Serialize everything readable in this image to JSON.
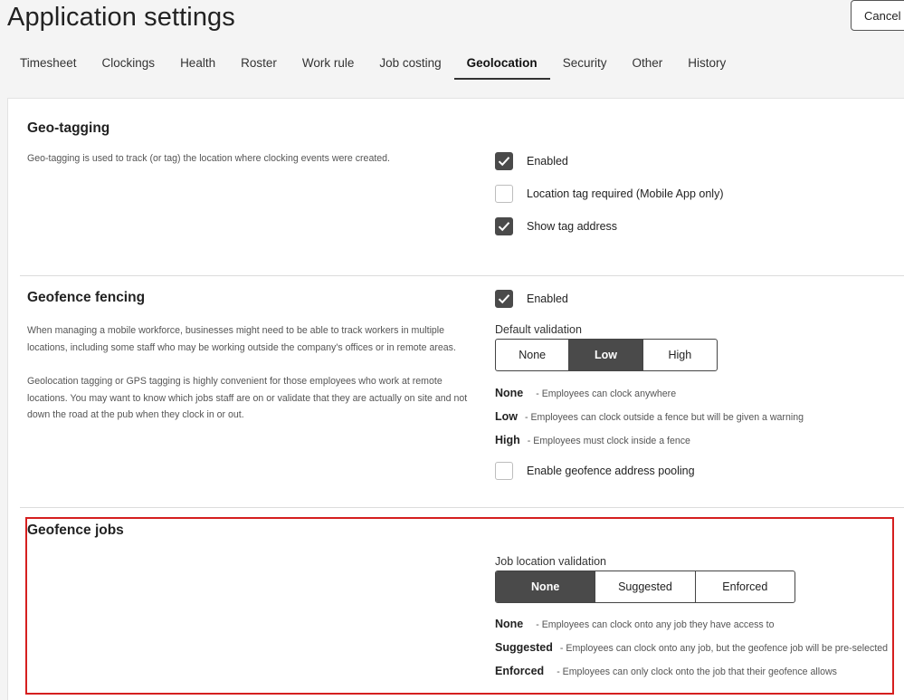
{
  "header": {
    "title": "Application settings",
    "cancel_label": "Cancel"
  },
  "tabs": [
    {
      "label": "Timesheet"
    },
    {
      "label": "Clockings"
    },
    {
      "label": "Health"
    },
    {
      "label": "Roster"
    },
    {
      "label": "Work rule"
    },
    {
      "label": "Job costing"
    },
    {
      "label": "Geolocation",
      "active": true
    },
    {
      "label": "Security"
    },
    {
      "label": "Other"
    },
    {
      "label": "History"
    }
  ],
  "geo_tagging": {
    "title": "Geo-tagging",
    "description": "Geo-tagging is used to track (or tag) the location where clocking events were created.",
    "options": [
      {
        "label": "Enabled",
        "checked": true
      },
      {
        "label": "Location tag required (Mobile App only)",
        "checked": false
      },
      {
        "label": "Show tag address",
        "checked": true
      }
    ]
  },
  "geofence_fencing": {
    "title": "Geofence fencing",
    "description_1": "When managing a mobile workforce, businesses might need to be able to track workers in multiple locations, including some staff who may be working outside the company's offices or in remote areas.",
    "description_2": "Geolocation tagging or GPS tagging is highly convenient for those employees who work at remote locations. You may want to know which jobs staff are on or validate that they are actually on site and not down the road at the pub when they clock in or out.",
    "enabled": {
      "label": "Enabled",
      "checked": true
    },
    "validation_label": "Default validation",
    "validation_options": [
      "None",
      "Low",
      "High"
    ],
    "validation_selected": "Low",
    "legend": [
      {
        "name": "None",
        "desc": "- Employees can clock anywhere"
      },
      {
        "name": "Low",
        "desc": "- Employees can clock outside a fence but will be given a warning"
      },
      {
        "name": "High",
        "desc": "- Employees must clock inside a fence"
      }
    ],
    "pooling": {
      "label": "Enable geofence address pooling",
      "checked": false
    }
  },
  "geofence_jobs": {
    "title": "Geofence jobs",
    "validation_label": "Job location validation",
    "validation_options": [
      "None",
      "Suggested",
      "Enforced"
    ],
    "validation_selected": "None",
    "legend": [
      {
        "name": "None",
        "desc": "- Employees can clock onto any job they have access to"
      },
      {
        "name": "Suggested",
        "desc": "- Employees can clock onto any job, but the geofence job will be pre-selected"
      },
      {
        "name": "Enforced",
        "desc": "- Employees can only clock onto the job that their geofence allows"
      }
    ]
  },
  "colors": {
    "accent_dark": "#4a4a4a",
    "highlight": "#d51f1f"
  }
}
